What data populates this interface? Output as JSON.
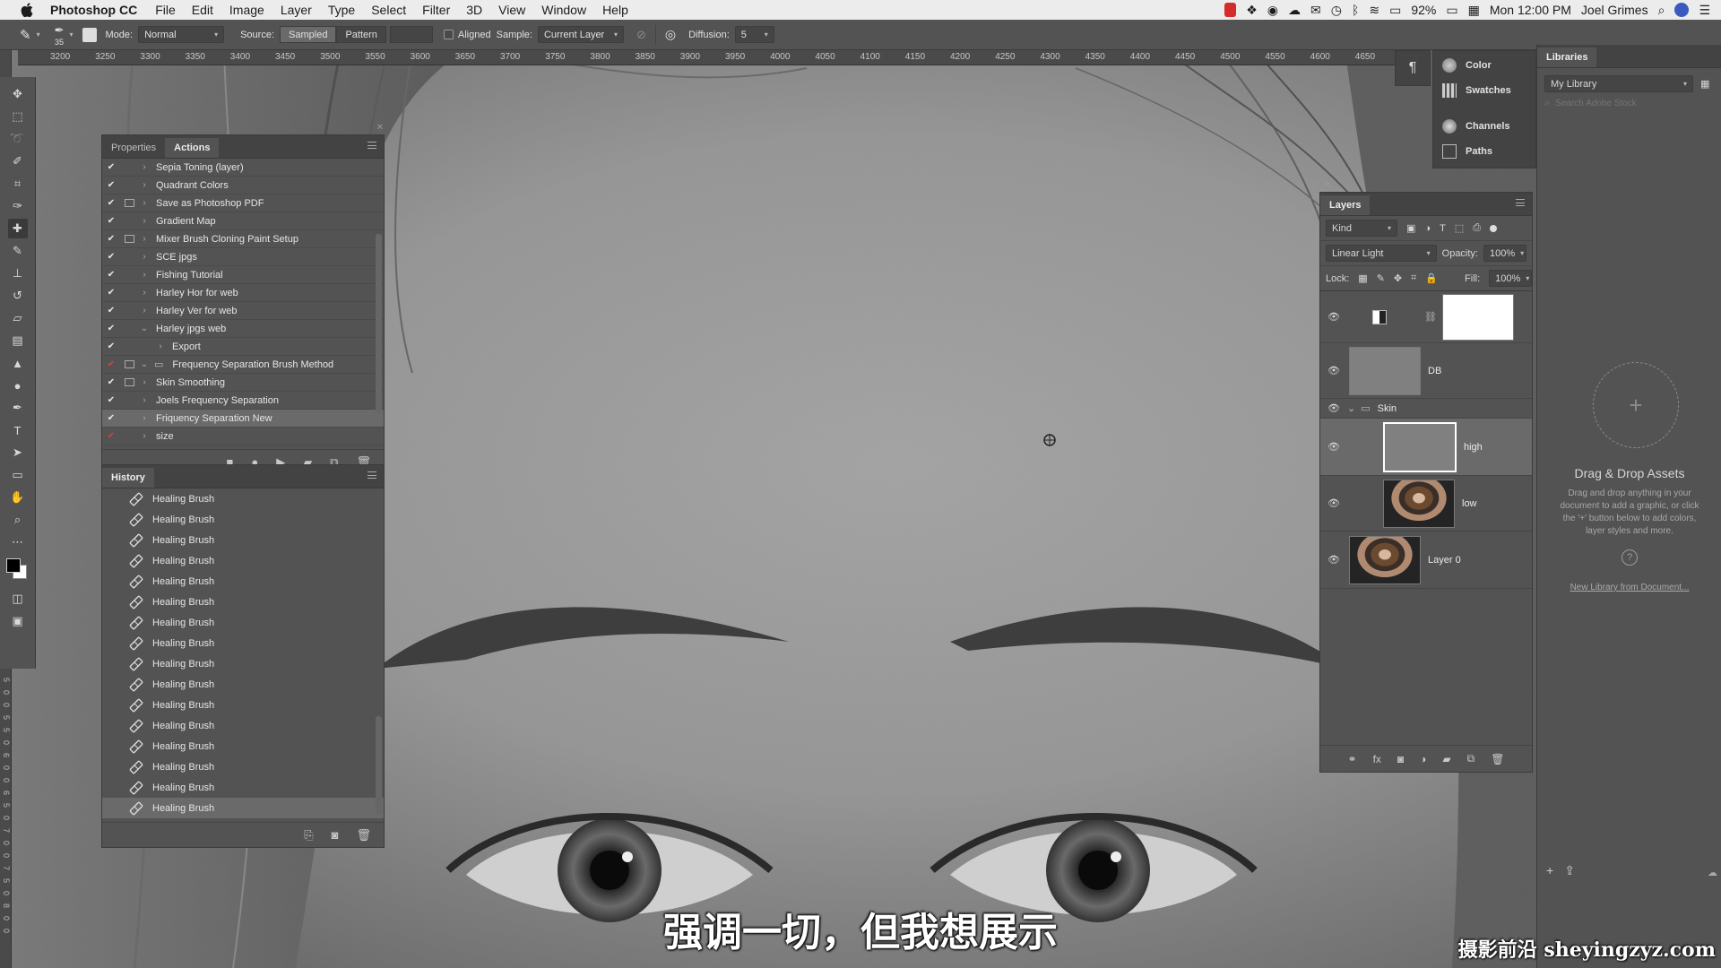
{
  "menubar": {
    "app": "Photoshop CC",
    "menus": [
      "File",
      "Edit",
      "Image",
      "Layer",
      "Type",
      "Select",
      "Filter",
      "3D",
      "View",
      "Window",
      "Help"
    ],
    "battery": "92%",
    "clock": "Mon 12:00 PM",
    "user": "Joel Grimes"
  },
  "options": {
    "brush_size": "35",
    "mode_label": "Mode:",
    "mode_value": "Normal",
    "source_label": "Source:",
    "source_sampled": "Sampled",
    "source_pattern": "Pattern",
    "aligned_label": "Aligned",
    "sample_label": "Sample:",
    "sample_value": "Current Layer",
    "diffusion_label": "Diffusion:",
    "diffusion_value": "5"
  },
  "ruler": {
    "top": [
      "3200",
      "3250",
      "3300",
      "3350",
      "3400",
      "3450",
      "3500",
      "3550",
      "3600",
      "3650",
      "3700",
      "3750",
      "3800",
      "3850",
      "3900",
      "3950",
      "4000",
      "4050",
      "4100",
      "4150",
      "4200",
      "4250",
      "4300",
      "4350",
      "4400",
      "4450",
      "4500",
      "4550",
      "4600",
      "4650"
    ],
    "left": [
      "5",
      "0",
      "0",
      "5",
      "5",
      "0",
      "6",
      "0",
      "0",
      "6",
      "5",
      "0",
      "7",
      "0",
      "0",
      "7",
      "5",
      "0",
      "8",
      "0",
      "0"
    ]
  },
  "actions_panel": {
    "tab_properties": "Properties",
    "tab_actions": "Actions",
    "items": [
      {
        "label": "Sepia Toning (layer)",
        "check_red": false,
        "dialog": false,
        "expanded": false,
        "indent": 0
      },
      {
        "label": "Quadrant Colors",
        "check_red": false,
        "dialog": false,
        "expanded": false,
        "indent": 0
      },
      {
        "label": "Save as Photoshop PDF",
        "check_red": false,
        "dialog": true,
        "expanded": false,
        "indent": 0
      },
      {
        "label": "Gradient Map",
        "check_red": false,
        "dialog": false,
        "expanded": false,
        "indent": 0
      },
      {
        "label": "Mixer Brush Cloning Paint Setup",
        "check_red": false,
        "dialog": true,
        "expanded": false,
        "indent": 0
      },
      {
        "label": "SCE jpgs",
        "check_red": false,
        "dialog": false,
        "expanded": false,
        "indent": 0
      },
      {
        "label": "Fishing Tutorial",
        "check_red": false,
        "dialog": false,
        "expanded": false,
        "indent": 0
      },
      {
        "label": "Harley Hor for web",
        "check_red": false,
        "dialog": false,
        "expanded": false,
        "indent": 0
      },
      {
        "label": "Harley Ver for web",
        "check_red": false,
        "dialog": false,
        "expanded": false,
        "indent": 0
      },
      {
        "label": "Harley jpgs web",
        "check_red": false,
        "dialog": false,
        "expanded": true,
        "indent": 0
      },
      {
        "label": "Export",
        "check_red": false,
        "dialog": false,
        "expanded": false,
        "indent": 1
      },
      {
        "label": "Frequency Separation Brush Method",
        "check_red": true,
        "dialog": true,
        "expanded": true,
        "indent": 2
      },
      {
        "label": "Skin Smoothing",
        "check_red": false,
        "dialog": true,
        "expanded": false,
        "indent": 0
      },
      {
        "label": "Joels Frequency Separation",
        "check_red": false,
        "dialog": false,
        "expanded": false,
        "indent": 0
      },
      {
        "label": "Friquency Separation New",
        "check_red": false,
        "dialog": false,
        "expanded": false,
        "indent": 0,
        "selected": true
      },
      {
        "label": "size",
        "check_red": true,
        "dialog": false,
        "expanded": false,
        "indent": 0
      }
    ]
  },
  "history_panel": {
    "title": "History",
    "items": [
      "Healing Brush",
      "Healing Brush",
      "Healing Brush",
      "Healing Brush",
      "Healing Brush",
      "Healing Brush",
      "Healing Brush",
      "Healing Brush",
      "Healing Brush",
      "Healing Brush",
      "Healing Brush",
      "Healing Brush",
      "Healing Brush",
      "Healing Brush",
      "Healing Brush",
      "Healing Brush"
    ]
  },
  "layers_panel": {
    "title": "Layers",
    "filter_kind": "Kind",
    "blend_mode": "Linear Light",
    "opacity_label": "Opacity:",
    "opacity_value": "100%",
    "lock_label": "Lock:",
    "fill_label": "Fill:",
    "fill_value": "100%",
    "layers": [
      {
        "name": "",
        "type": "adjustment"
      },
      {
        "name": "DB",
        "type": "gray"
      },
      {
        "name": "Skin",
        "type": "group"
      },
      {
        "name": "high",
        "type": "gray",
        "selected": true
      },
      {
        "name": "low",
        "type": "photo"
      },
      {
        "name": "Layer 0",
        "type": "photo"
      }
    ]
  },
  "mini_panels": [
    "Color",
    "Swatches",
    "Channels",
    "Paths"
  ],
  "libraries_panel": {
    "title": "Libraries",
    "library": "My Library",
    "search_placeholder": "Search Adobe Stock",
    "drop_title": "Drag & Drop Assets",
    "drop_text": "Drag and drop anything in your document to add a graphic, or click the '+' button below to add colors, layer styles and more.",
    "new_library_link": "New Library from Document..."
  },
  "subtitle": "强调一切，但我想展示",
  "watermark": "摄影前沿 sheyingzyz.com",
  "colors": {
    "panel_bg": "#535353",
    "panel_dark": "#434343",
    "selected_row": "#6a6a6a",
    "check_red": "#e23b3b",
    "menubar_bg": "#ececec"
  }
}
